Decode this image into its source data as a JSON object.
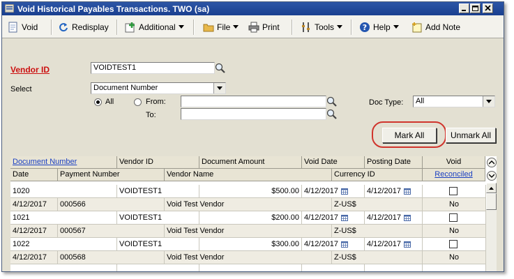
{
  "window": {
    "title": "Void Historical Payables Transactions.  TWO (sa)"
  },
  "toolbar": {
    "void": "Void",
    "redisplay": "Redisplay",
    "additional": "Additional",
    "file": "File",
    "print": "Print",
    "tools": "Tools",
    "help": "Help",
    "add_note": "Add Note"
  },
  "form": {
    "vendor_id_label": "Vendor ID",
    "vendor_id_value": "VOIDTEST1",
    "select_label": "Select",
    "select_value": "Document Number",
    "all_label": "All",
    "from_label": "From:",
    "to_label": "To:",
    "from_value": "",
    "to_value": "",
    "doc_type_label": "Doc Type:",
    "doc_type_value": "All",
    "mark_all": "Mark All",
    "unmark_all": "Unmark All"
  },
  "grid": {
    "header1": [
      "Document Number",
      "Vendor ID",
      "Document Amount",
      "Void Date",
      "Posting Date",
      "Void"
    ],
    "header2": [
      "Date",
      "Payment Number",
      "Vendor Name",
      "Currency ID",
      "Reconciled"
    ],
    "rows": [
      {
        "doc": "1020",
        "vendor_id": "VOIDTEST1",
        "amount": "$500.00",
        "void_date": "4/12/2017",
        "posting_date": "4/12/2017",
        "void": false,
        "date": "4/12/2017",
        "payment_number": "000566",
        "vendor_name": "Void Test Vendor",
        "currency": "Z-US$",
        "reconciled": "No"
      },
      {
        "doc": "1021",
        "vendor_id": "VOIDTEST1",
        "amount": "$200.00",
        "void_date": "4/12/2017",
        "posting_date": "4/12/2017",
        "void": false,
        "date": "4/12/2017",
        "payment_number": "000567",
        "vendor_name": "Void Test Vendor",
        "currency": "Z-US$",
        "reconciled": "No"
      },
      {
        "doc": "1022",
        "vendor_id": "VOIDTEST1",
        "amount": "$300.00",
        "void_date": "4/12/2017",
        "posting_date": "4/12/2017",
        "void": false,
        "date": "4/12/2017",
        "payment_number": "000568",
        "vendor_name": "Void Test Vendor",
        "currency": "Z-US$",
        "reconciled": "No"
      }
    ]
  },
  "colors": {
    "title_bar": "#1f4795",
    "required_label": "#cc1010",
    "link": "#1a3fc2",
    "callout": "#d0342c"
  }
}
